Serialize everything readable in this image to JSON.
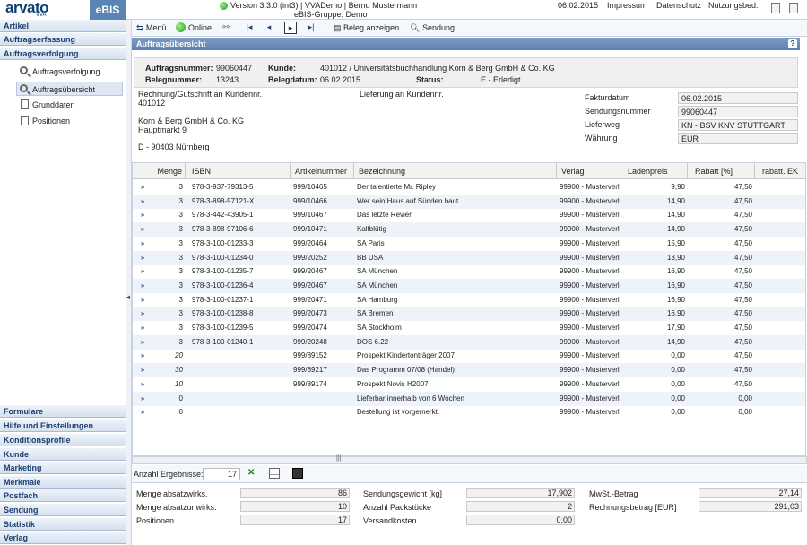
{
  "app": {
    "brand": "arvato",
    "brand_sub": "VVA",
    "product": "eBIS",
    "version_line": "Version 3.3.0 (int3) | VVADemo | Bernd Mustermann",
    "group_line": "eBIS-Gruppe: Demo",
    "date": "06.02.2015",
    "links": [
      "Impressum",
      "Datenschutz",
      "Nutzungsbed."
    ]
  },
  "sidebar": {
    "sections_top": [
      "Artikel",
      "Auftragserfassung",
      "Auftragsverfolgung"
    ],
    "sub_items": [
      {
        "label": "Auftragsverfolgung",
        "icon": "magnifier-icon",
        "selected": false
      },
      {
        "label": "Auftragsübersicht",
        "icon": "magnifier-icon",
        "selected": true
      },
      {
        "label": "Grunddaten",
        "icon": "document-icon",
        "selected": false
      },
      {
        "label": "Positionen",
        "icon": "document-icon",
        "selected": false
      }
    ],
    "sections_bottom": [
      "Formulare",
      "Hilfe und Einstellungen",
      "Konditionsprofile",
      "Kunde",
      "Marketing",
      "Merkmale",
      "Postfach",
      "Sendung",
      "Statistik",
      "Verlag"
    ]
  },
  "toolbar": {
    "menu": "Menü",
    "online": "Online",
    "beleg": "Beleg anzeigen",
    "sendung": "Sendung"
  },
  "page": {
    "title": "Auftragsübersicht",
    "help": "?"
  },
  "kopf": {
    "auftragsnummer_label": "Auftragsnummer:",
    "auftragsnummer": "99060447",
    "kunde_label": "Kunde:",
    "kunde": "401012 / Universitätsbuchhandlung Korn & Berg GmbH & Co. KG",
    "belegnummer_label": "Belegnummer:",
    "belegnummer": "13243",
    "belegdatum_label": "Belegdatum:",
    "belegdatum": "06.02.2015",
    "status_label": "Status:",
    "status": "E - Erledigt"
  },
  "rechnung": {
    "heading": "Rechnung/Gutschrift an Kundennr.",
    "kundennr": "401012",
    "name": "Korn & Berg GmbH & Co. KG",
    "strasse": "Hauptmarkt 9",
    "ort": "D - 90403 Nürnberg"
  },
  "lieferung": {
    "heading": "Lieferung an Kundennr."
  },
  "fields": [
    {
      "label": "Fakturdatum",
      "value": "06.02.2015"
    },
    {
      "label": "Sendungsnummer",
      "value": "99060447"
    },
    {
      "label": "Lieferweg",
      "value": "KN - BSV KNV STUTTGART"
    },
    {
      "label": "Währung",
      "value": "EUR"
    }
  ],
  "table": {
    "columns": [
      "Menge",
      "ISBN",
      "Artikelnummer",
      "Bezeichnung",
      "Verlag",
      "Ladenpreis",
      "Rabatt [%]",
      "rabatt. EK"
    ],
    "row_action": "»",
    "rows": [
      {
        "menge": "3",
        "isbn": "978-3-937-79313-5",
        "art": "999/10465",
        "bez": "Der talentierte Mr. Ripley",
        "verlag": "99900 - Musterverla",
        "preis": "9,90",
        "rabatt": "47,50"
      },
      {
        "menge": "3",
        "isbn": "978-3-898-97121-X",
        "art": "999/10466",
        "bez": "Wer sein Haus auf Sünden baut",
        "verlag": "99900 - Musterverla",
        "preis": "14,90",
        "rabatt": "47,50"
      },
      {
        "menge": "3",
        "isbn": "978-3-442-43905-1",
        "art": "999/10467",
        "bez": "Das letzte Revier",
        "verlag": "99900 - Musterverla",
        "preis": "14,90",
        "rabatt": "47,50"
      },
      {
        "menge": "3",
        "isbn": "978-3-898-97106-6",
        "art": "999/10471",
        "bez": "Kaltblütig",
        "verlag": "99900 - Musterverla",
        "preis": "14,90",
        "rabatt": "47,50"
      },
      {
        "menge": "3",
        "isbn": "978-3-100-01233-3",
        "art": "999/20464",
        "bez": "SA Paris",
        "verlag": "99900 - Musterverla",
        "preis": "15,90",
        "rabatt": "47,50"
      },
      {
        "menge": "3",
        "isbn": "978-3-100-01234-0",
        "art": "999/20252",
        "bez": "BB USA",
        "verlag": "99900 - Musterverla",
        "preis": "13,90",
        "rabatt": "47,50"
      },
      {
        "menge": "3",
        "isbn": "978-3-100-01235-7",
        "art": "999/20467",
        "bez": "SA München",
        "verlag": "99900 - Musterverla",
        "preis": "16,90",
        "rabatt": "47,50"
      },
      {
        "menge": "3",
        "isbn": "978-3-100-01236-4",
        "art": "999/20467",
        "bez": "SA München",
        "verlag": "99900 - Musterverla",
        "preis": "16,90",
        "rabatt": "47,50"
      },
      {
        "menge": "3",
        "isbn": "978-3-100-01237-1",
        "art": "999/20471",
        "bez": "SA Hamburg",
        "verlag": "99900 - Musterverla",
        "preis": "16,90",
        "rabatt": "47,50"
      },
      {
        "menge": "3",
        "isbn": "978-3-100-01238-8",
        "art": "999/20473",
        "bez": "SA Bremen",
        "verlag": "99900 - Musterverla",
        "preis": "16,90",
        "rabatt": "47,50"
      },
      {
        "menge": "3",
        "isbn": "978-3-100-01239-5",
        "art": "999/20474",
        "bez": "SA Stockholm",
        "verlag": "99900 - Musterverla",
        "preis": "17,90",
        "rabatt": "47,50"
      },
      {
        "menge": "3",
        "isbn": "978-3-100-01240-1",
        "art": "999/20248",
        "bez": "DOS 6.22",
        "verlag": "99900 - Musterverla",
        "preis": "14,90",
        "rabatt": "47,50"
      },
      {
        "menge": "20",
        "isbn": "",
        "art": "999/89152",
        "bez": "Prospekt Kindertonträger 2007",
        "verlag": "99900 - Musterverla",
        "preis": "0,00",
        "rabatt": "47,50"
      },
      {
        "menge": "30",
        "isbn": "",
        "art": "999/89217",
        "bez": "Das Programm 07/08 (Handel)",
        "verlag": "99900 - Musterverla",
        "preis": "0,00",
        "rabatt": "47,50"
      },
      {
        "menge": "10",
        "isbn": "",
        "art": "999/89174",
        "bez": "Prospekt Novis H2007",
        "verlag": "99900 - Musterverla",
        "preis": "0,00",
        "rabatt": "47,50"
      },
      {
        "menge": "0",
        "isbn": "",
        "art": "",
        "bez": "Lieferbar innerhalb von 6 Wochen",
        "verlag": "99900 - Musterverla",
        "preis": "0,00",
        "rabatt": "0,00"
      },
      {
        "menge": "0",
        "isbn": "",
        "art": "",
        "bez": "Bestellung ist vorgemerkt.",
        "verlag": "99900 - Musterverla",
        "preis": "0,00",
        "rabatt": "0,00"
      }
    ]
  },
  "results": {
    "label": "Anzahl Ergebnisse:",
    "value": "17"
  },
  "summary": {
    "col1": [
      {
        "label": "Menge absatzwirks.",
        "value": "86"
      },
      {
        "label": "Menge absatzunwirks.",
        "value": "10"
      },
      {
        "label": "Positionen",
        "value": "17"
      }
    ],
    "col2": [
      {
        "label": "Sendungsgewicht [kg]",
        "value": "17,902"
      },
      {
        "label": "Anzahl Packstücke",
        "value": "2"
      },
      {
        "label": "Versandkosten",
        "value": "0,00"
      }
    ],
    "col3": [
      {
        "label": "MwSt.-Betrag",
        "value": "27,14"
      },
      {
        "label": "Rechnungsbetrag [EUR]",
        "value": "291,03"
      }
    ]
  }
}
